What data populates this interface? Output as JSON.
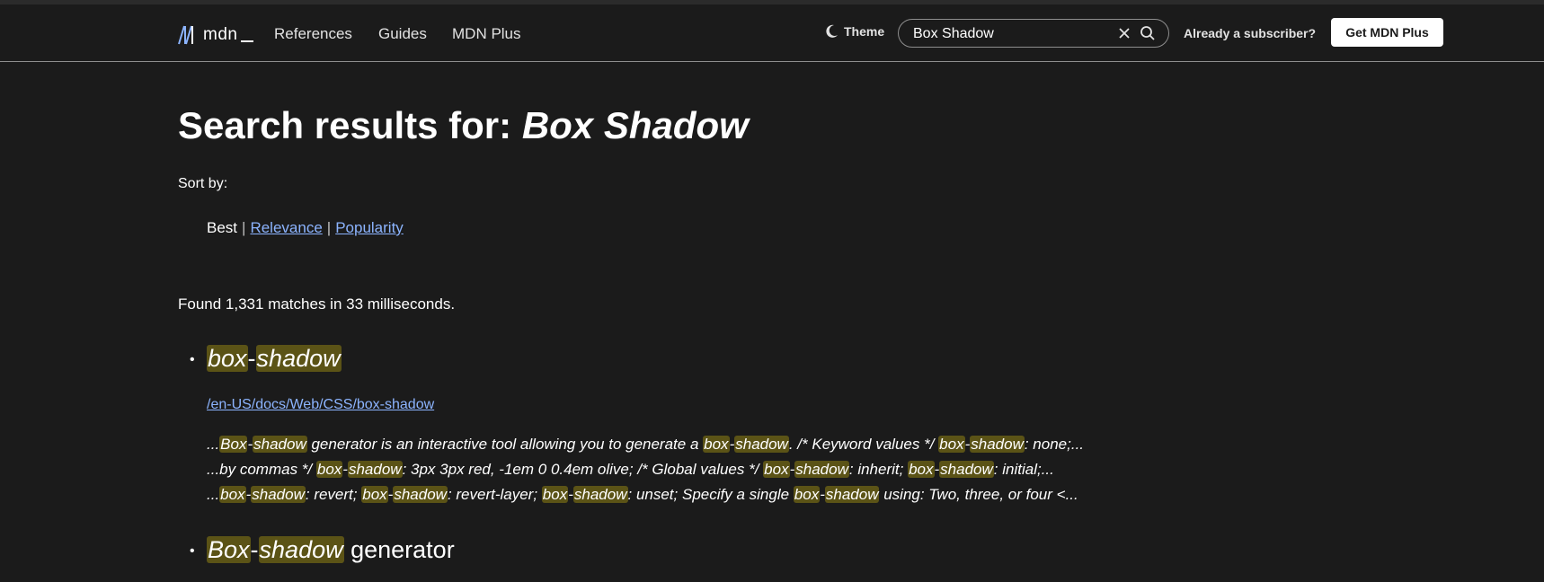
{
  "header": {
    "logo_text": "mdn",
    "nav": [
      "References",
      "Guides",
      "MDN Plus"
    ],
    "theme_label": "Theme",
    "search_value": "Box Shadow",
    "subscriber_label": "Already a subscriber?",
    "get_plus_label": "Get MDN Plus"
  },
  "page": {
    "title_prefix": "Search results for: ",
    "query": "Box Shadow",
    "sort_by_label": "Sort by:",
    "sort": {
      "best": "Best",
      "sep": "|",
      "relevance": "Relevance",
      "popularity": "Popularity"
    },
    "found_text": "Found 1,331 matches in 33 milliseconds."
  },
  "results": [
    {
      "title_parts": [
        {
          "text": "box",
          "hl": true
        },
        {
          "text": "-",
          "hl": false
        },
        {
          "text": "shadow",
          "hl": true
        }
      ],
      "url": "/en-US/docs/Web/CSS/box-shadow",
      "snippets": [
        [
          {
            "text": "...",
            "hl": false
          },
          {
            "text": "Box",
            "hl": true
          },
          {
            "text": "-",
            "hl": false
          },
          {
            "text": "shadow",
            "hl": true
          },
          {
            "text": " generator is an interactive tool allowing you to generate a ",
            "hl": false
          },
          {
            "text": "box",
            "hl": true
          },
          {
            "text": "-",
            "hl": false
          },
          {
            "text": "shadow",
            "hl": true
          },
          {
            "text": ". /* Keyword values */ ",
            "hl": false
          },
          {
            "text": "box",
            "hl": true
          },
          {
            "text": "-",
            "hl": false
          },
          {
            "text": "shadow",
            "hl": true
          },
          {
            "text": ": none;...",
            "hl": false
          }
        ],
        [
          {
            "text": "...by commas */ ",
            "hl": false
          },
          {
            "text": "box",
            "hl": true
          },
          {
            "text": "-",
            "hl": false
          },
          {
            "text": "shadow",
            "hl": true
          },
          {
            "text": ": 3px 3px red, -1em 0 0.4em olive; /* Global values */ ",
            "hl": false
          },
          {
            "text": "box",
            "hl": true
          },
          {
            "text": "-",
            "hl": false
          },
          {
            "text": "shadow",
            "hl": true
          },
          {
            "text": ": inherit; ",
            "hl": false
          },
          {
            "text": "box",
            "hl": true
          },
          {
            "text": "-",
            "hl": false
          },
          {
            "text": "shadow",
            "hl": true
          },
          {
            "text": ": initial;...",
            "hl": false
          }
        ],
        [
          {
            "text": "...",
            "hl": false
          },
          {
            "text": "box",
            "hl": true
          },
          {
            "text": "-",
            "hl": false
          },
          {
            "text": "shadow",
            "hl": true
          },
          {
            "text": ": revert; ",
            "hl": false
          },
          {
            "text": "box",
            "hl": true
          },
          {
            "text": "-",
            "hl": false
          },
          {
            "text": "shadow",
            "hl": true
          },
          {
            "text": ": revert-layer; ",
            "hl": false
          },
          {
            "text": "box",
            "hl": true
          },
          {
            "text": "-",
            "hl": false
          },
          {
            "text": "shadow",
            "hl": true
          },
          {
            "text": ": unset; Specify a single ",
            "hl": false
          },
          {
            "text": "box",
            "hl": true
          },
          {
            "text": "-",
            "hl": false
          },
          {
            "text": "shadow",
            "hl": true
          },
          {
            "text": " using: Two, three, or four <...",
            "hl": false
          }
        ]
      ]
    },
    {
      "title_parts": [
        {
          "text": "Box",
          "hl": true
        },
        {
          "text": "-",
          "hl": false
        },
        {
          "text": "shadow",
          "hl": true
        },
        {
          "text": " generator",
          "hl": false
        }
      ]
    }
  ],
  "colors": {
    "background": "#1b1b1b",
    "link": "#8cb4ff",
    "highlight": "#5b5316"
  }
}
